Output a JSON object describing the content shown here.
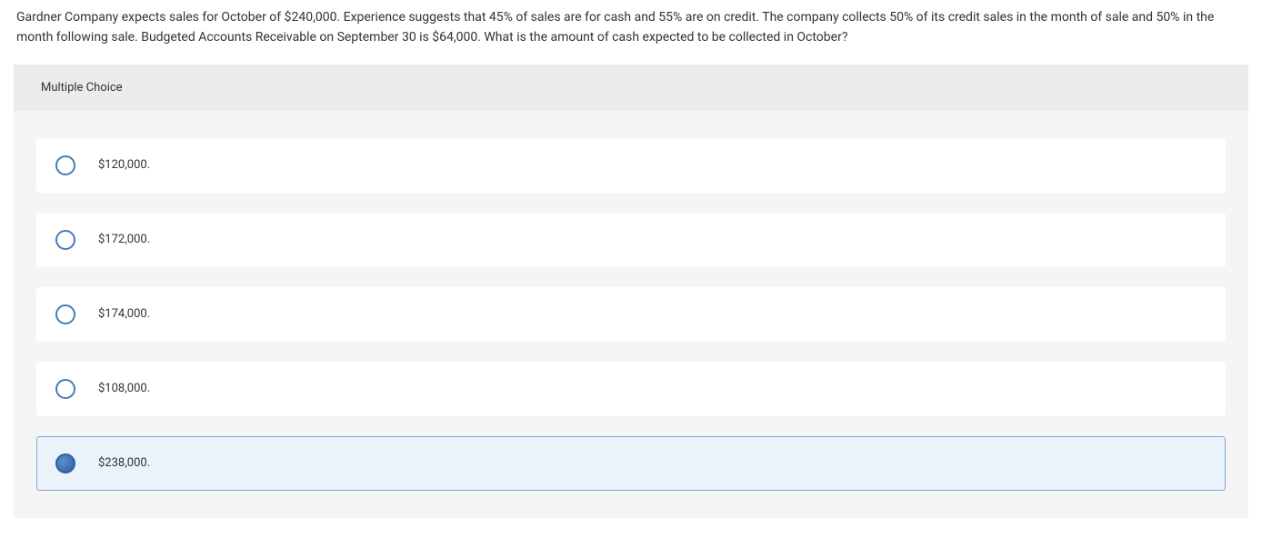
{
  "question": {
    "text": "Gardner Company expects sales for October of $240,000. Experience suggests that 45% of sales are for cash and 55% are on credit. The company collects 50% of its credit sales in the month of sale and 50% in the month following sale. Budgeted Accounts Receivable on September 30 is $64,000. What is the amount of cash expected to be collected in October?"
  },
  "header": {
    "label": "Multiple Choice"
  },
  "options": [
    {
      "label": "$120,000.",
      "selected": false
    },
    {
      "label": "$172,000.",
      "selected": false
    },
    {
      "label": "$174,000.",
      "selected": false
    },
    {
      "label": "$108,000.",
      "selected": false
    },
    {
      "label": "$238,000.",
      "selected": true
    }
  ]
}
